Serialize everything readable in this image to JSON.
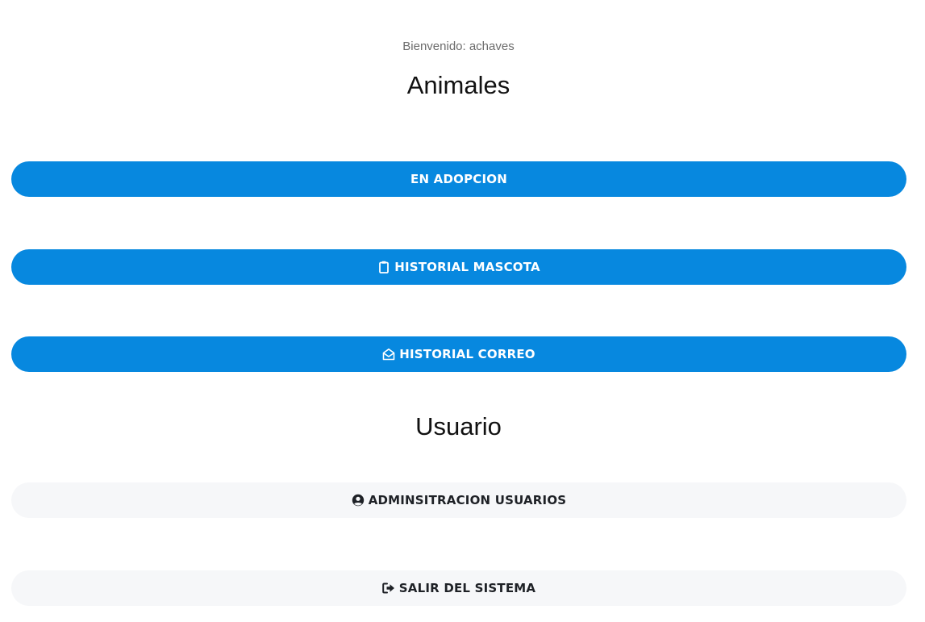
{
  "header": {
    "welcome_text": "Bienvenido: achaves"
  },
  "animales": {
    "title": "Animales",
    "buttons": [
      {
        "label": "EN ADOPCION",
        "icon": ""
      },
      {
        "label": "HISTORIAL MASCOTA",
        "icon": "clipboard-icon"
      },
      {
        "label": "HISTORIAL CORREO",
        "icon": "envelope-open-icon"
      }
    ]
  },
  "usuario": {
    "title": "Usuario",
    "buttons": [
      {
        "label": "ADMINSITRACION USUARIOS",
        "icon": "user-circle-icon"
      },
      {
        "label": "SALIR DEL SISTEMA",
        "icon": "sign-out-icon"
      }
    ]
  },
  "colors": {
    "primary": "#0788df",
    "light": "#f6f7f9",
    "dark_text": "#1e2126"
  }
}
